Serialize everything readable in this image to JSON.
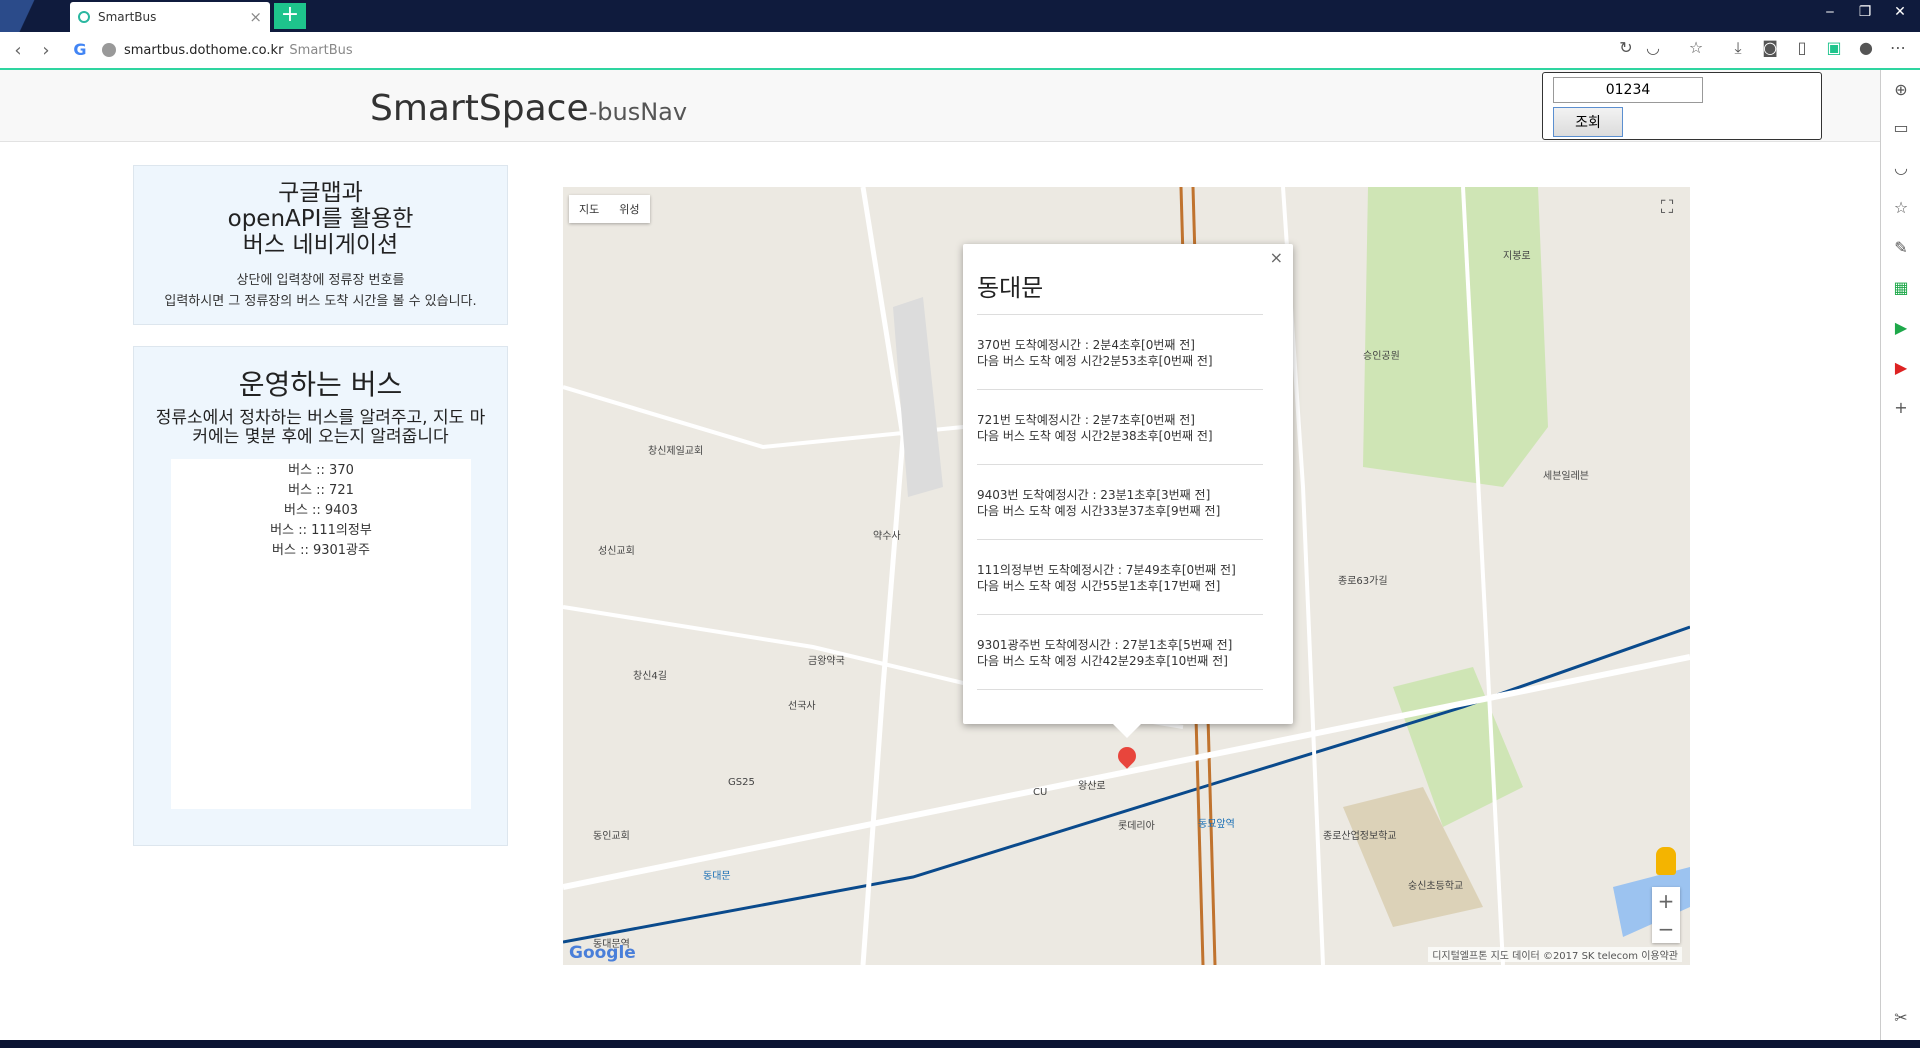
{
  "browser": {
    "tab_title": "SmartBus",
    "url_host": "smartbus.dothome.co.kr",
    "url_suffix": "SmartBus"
  },
  "header": {
    "title_main": "SmartSpace",
    "title_sub": "-busNav",
    "stop_input_value": "01234",
    "query_button": "조회"
  },
  "panel1": {
    "line1": "구글맵과",
    "line2": "openAPI를 활용한",
    "line3": "버스 네비게이션",
    "desc1": "상단에 입력창에 정류장 번호를",
    "desc2": "입력하시면 그 정류장의 버스 도착 시간을 볼 수 있습니다."
  },
  "panel2": {
    "heading": "운영하는 버스",
    "desc1": "정류소에서 정차하는 버스를 알려주고, 지도 마",
    "desc2": "커에는 몇분 후에 오는지 알려줍니다",
    "buses": [
      "버스 :: 370",
      "버스 :: 721",
      "버스 :: 9403",
      "버스 :: 111의정부",
      "버스 :: 9301광주"
    ]
  },
  "map": {
    "type_map": "지도",
    "type_satellite": "위성",
    "google": "Google",
    "copyright": "디지털엘프톤 지도 데이터 ©2017 SK telecom   이용약관",
    "labels": [
      "승인공원",
      "동대문",
      "동묘앞역",
      "종로63가길",
      "숭신초등학교",
      "종로산업정보학교",
      "세븐일레븐",
      "창신4길",
      "금왕약국",
      "선국사",
      "약수사",
      "창신제일교회",
      "지봉로",
      "왕산로",
      "동대문역",
      "CU",
      "GS25",
      "롯데리아",
      "성신교회",
      "동인교회"
    ]
  },
  "infowindow": {
    "stop_name": "동대문",
    "arrivals": [
      {
        "line1": "370번 도착예정시간 : 2분4초후[0번째 전]",
        "line2": "다음 버스 도착 예정 시간2분53초후[0번째 전]"
      },
      {
        "line1": "721번 도착예정시간 : 2분7초후[0번째 전]",
        "line2": "다음 버스 도착 예정 시간2분38초후[0번째 전]"
      },
      {
        "line1": "9403번 도착예정시간 : 23분1초후[3번째 전]",
        "line2": "다음 버스 도착 예정 시간33분37초후[9번째 전]"
      },
      {
        "line1": "111의정부번 도착예정시간 : 7분49초후[0번째 전]",
        "line2": "다음 버스 도착 예정 시간55분1초후[17번째 전]"
      },
      {
        "line1": "9301광주번 도착예정시간 : 27분1초후[5번째 전]",
        "line2": "다음 버스 도착 예정 시간42분29초후[10번째 전]"
      }
    ]
  }
}
